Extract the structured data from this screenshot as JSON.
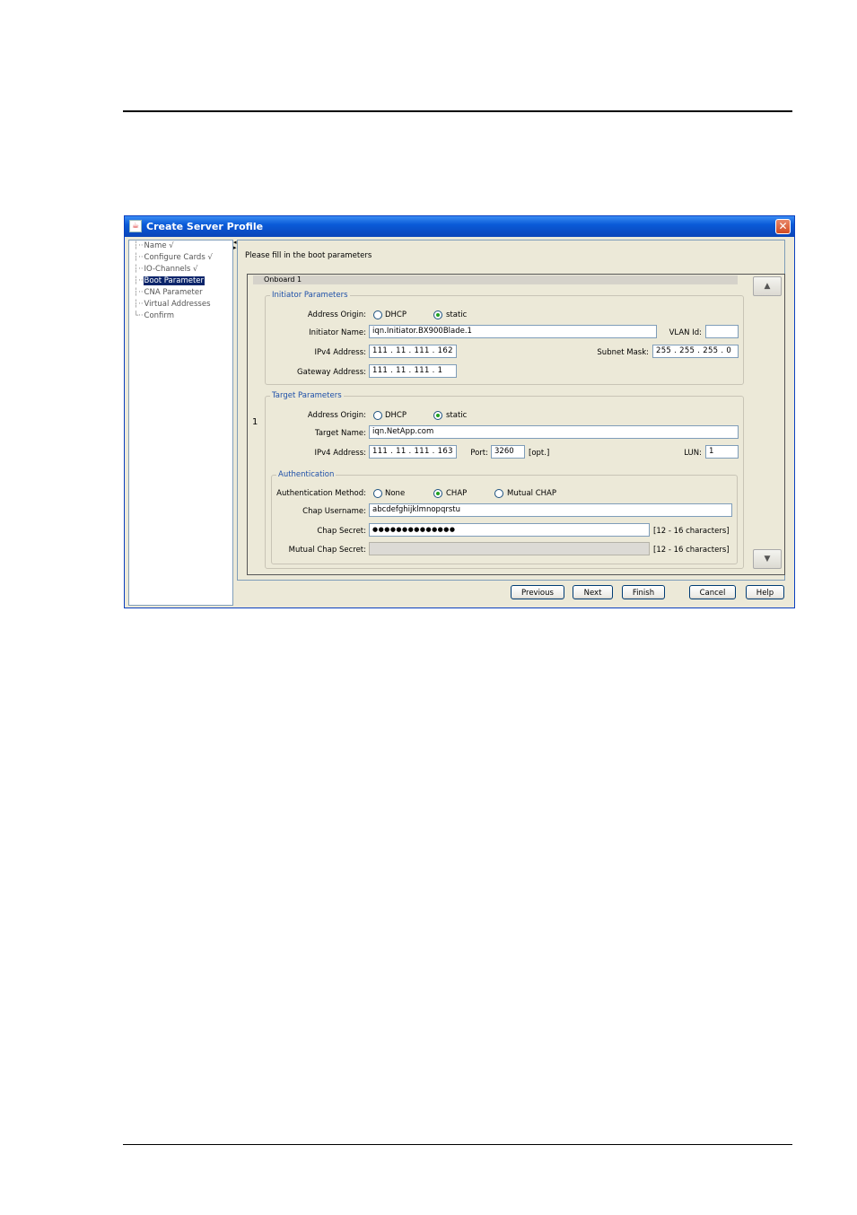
{
  "window": {
    "title": "Create Server Profile",
    "close_glyph": "✕",
    "icon": "java-cup-icon"
  },
  "nav": {
    "items": [
      {
        "label": "Name √",
        "selected": false
      },
      {
        "label": "Configure Cards √",
        "selected": false
      },
      {
        "label": "IO-Channels √",
        "selected": false
      },
      {
        "label": "Boot Parameter",
        "selected": true
      },
      {
        "label": "CNA Parameter",
        "selected": false
      },
      {
        "label": "Virtual Addresses",
        "selected": false
      },
      {
        "label": "Confirm",
        "selected": false
      }
    ]
  },
  "main": {
    "instruction": "Please fill in the boot parameters",
    "onboard_label": "Onboard 1",
    "row_number": "1",
    "initiator": {
      "legend": "Initiator Parameters",
      "address_origin_label": "Address Origin:",
      "dhcp_label": "DHCP",
      "static_label": "static",
      "selected_origin": "static",
      "name_label": "Initiator Name:",
      "name_value": "iqn.Initiator.BX900Blade.1",
      "vlan_label": "VLAN Id:",
      "vlan_value": "",
      "ipv4_label": "IPv4 Address:",
      "ipv4_value": "111 . 11 . 111 . 162",
      "subnet_label": "Subnet Mask:",
      "subnet_value": "255 . 255 . 255 . 0",
      "gateway_label": "Gateway Address:",
      "gateway_value": "111 . 11 . 111 . 1"
    },
    "target": {
      "legend": "Target Parameters",
      "address_origin_label": "Address Origin:",
      "dhcp_label": "DHCP",
      "static_label": "static",
      "selected_origin": "static",
      "name_label": "Target Name:",
      "name_value": "iqn.NetApp.com",
      "ipv4_label": "IPv4 Address:",
      "ipv4_value": "111 . 11 . 111 . 163",
      "port_label": "Port:",
      "port_value": "3260",
      "opt_label": "[opt.]",
      "lun_label": "LUN:",
      "lun_value": "1"
    },
    "auth": {
      "legend": "Authentication",
      "method_label": "Authentication Method:",
      "none_label": "None",
      "chap_label": "CHAP",
      "mutual_label": "Mutual CHAP",
      "selected_method": "CHAP",
      "username_label": "Chap Username:",
      "username_value": "abcdefghijklmnopqrstu",
      "secret_label": "Chap Secret:",
      "secret_value": "●●●●●●●●●●●●●●",
      "secret_hint": "[12 - 16 characters]",
      "mutual_secret_label": "Mutual Chap Secret:",
      "mutual_secret_value": "",
      "mutual_secret_hint": "[12 - 16 characters]"
    },
    "scroll_up_glyph": "▲",
    "scroll_down_glyph": "▼"
  },
  "buttons": {
    "previous": "Previous",
    "next": "Next",
    "finish": "Finish",
    "cancel": "Cancel",
    "help": "Help"
  }
}
